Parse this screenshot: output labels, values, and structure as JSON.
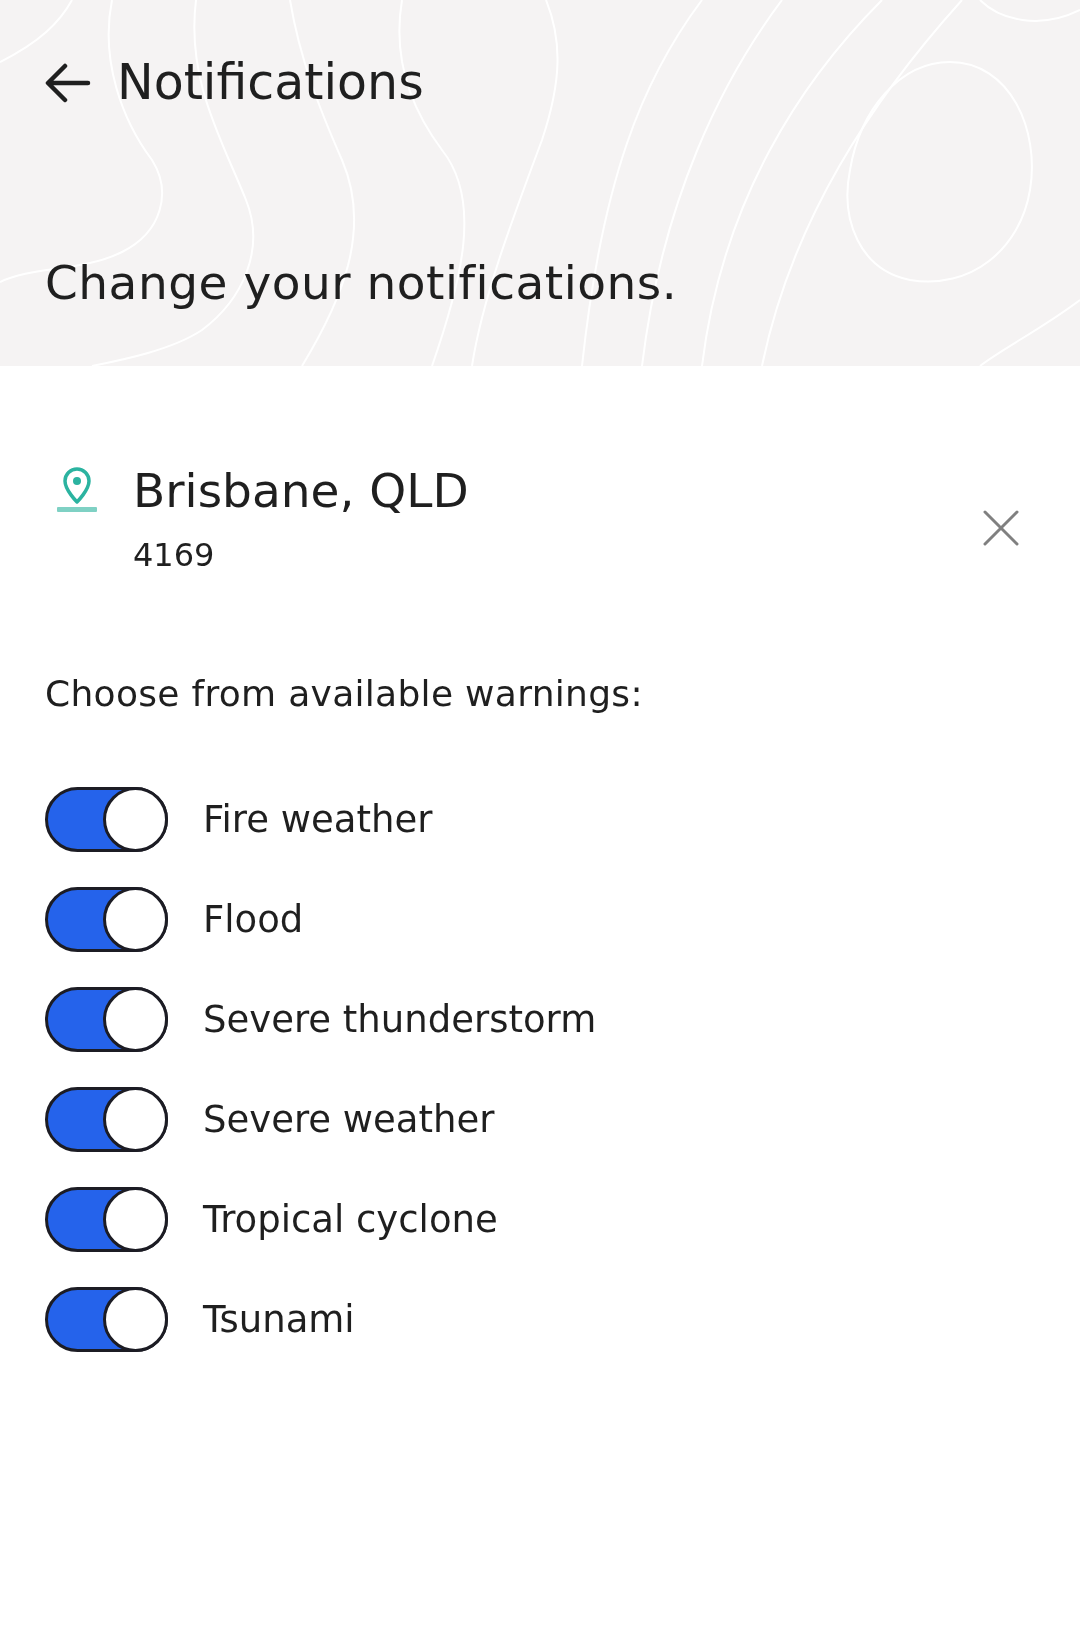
{
  "header": {
    "title": "Notifications",
    "subtitle": "Change your notifications."
  },
  "location": {
    "name": "Brisbane, QLD",
    "postcode": "4169"
  },
  "warnings": {
    "heading": "Choose from available warnings:",
    "items": [
      {
        "label": "Fire weather",
        "on": true
      },
      {
        "label": "Flood",
        "on": true
      },
      {
        "label": "Severe thunderstorm",
        "on": true
      },
      {
        "label": "Severe weather",
        "on": true
      },
      {
        "label": "Tropical cyclone",
        "on": true
      },
      {
        "label": "Tsunami",
        "on": true
      }
    ]
  }
}
